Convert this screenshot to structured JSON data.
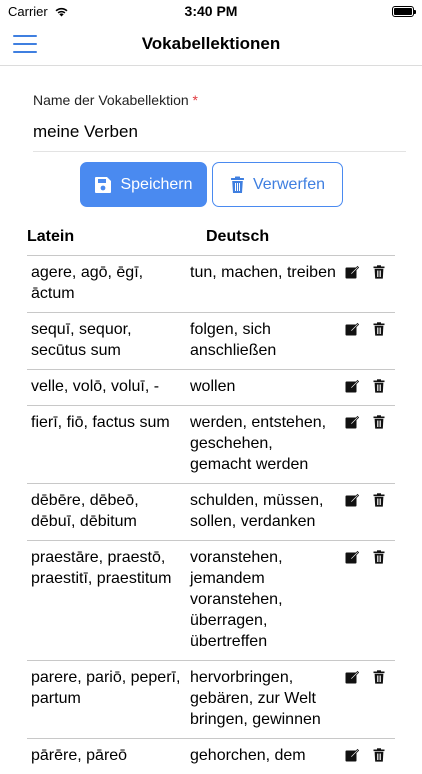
{
  "status_bar": {
    "carrier": "Carrier",
    "time": "3:40 PM",
    "battery_level": 1.0
  },
  "nav": {
    "title": "Vokabellektionen",
    "menu_icon": "hamburger-menu-icon",
    "accent_color": "#3f7fe0"
  },
  "form": {
    "name_label": "Name der Vokabellektion",
    "required_mark": "*",
    "name_value": "meine Verben"
  },
  "actions": {
    "save_label": "Speichern",
    "save_icon": "floppy-disk-icon",
    "discard_label": "Verwerfen",
    "discard_icon": "trash-icon"
  },
  "table": {
    "headers": {
      "latin": "Latein",
      "german": "Deutsch"
    },
    "rows": [
      {
        "latin": "agere, agō, ēgī, āctum",
        "german": "tun, machen, treiben"
      },
      {
        "latin": "sequī, sequor, secūtus sum",
        "german": "folgen, sich anschließen"
      },
      {
        "latin": "velle, volō, voluī, -",
        "german": "wollen"
      },
      {
        "latin": "fierī, fiō, factus sum",
        "german": "werden, entstehen, geschehen, gemacht werden"
      },
      {
        "latin": "dēbēre, dēbeō, dēbuī, dēbitum",
        "german": "schulden, müssen, sollen, verdanken"
      },
      {
        "latin": "praestāre, praestō, praestitī, praestitum",
        "german": "voranstehen, jemandem voranstehen, überragen, übertreffen"
      },
      {
        "latin": "parere, pariō, peperī, partum",
        "german": "hervorbringen, gebären, zur Welt bringen, gewinnen"
      },
      {
        "latin": "pārēre, pāreō",
        "german": "gehorchen, dem"
      }
    ],
    "row_edit_icon": "edit-icon",
    "row_delete_icon": "trash-icon"
  }
}
